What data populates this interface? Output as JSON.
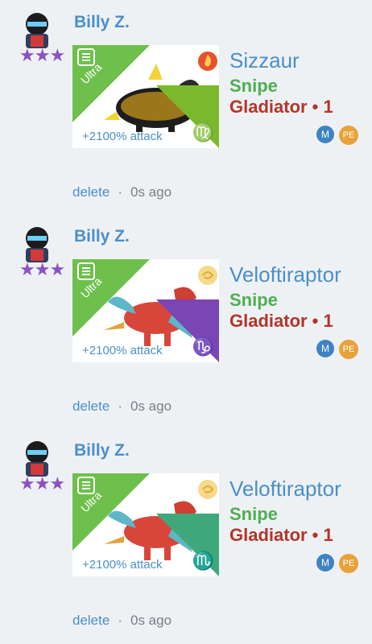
{
  "posts": [
    {
      "username": "Billy Z.",
      "stars": "★★★",
      "badge": "Ultra",
      "attack": "+2100% attack",
      "zodiac": "♍",
      "zodiac_color": "#7ab92c",
      "element_icon": "fire-icon",
      "dragon_name": "Sizzaur",
      "tag": "Snipe",
      "rank": "Gladiator • 1",
      "badges": [
        "M",
        "PE"
      ],
      "delete": "delete",
      "time": "0s ago"
    },
    {
      "username": "Billy Z.",
      "stars": "★★★",
      "badge": "Ultra",
      "attack": "+2100% attack",
      "zodiac": "♑",
      "zodiac_color": "#7a46b4",
      "element_icon": "wind-icon",
      "dragon_name": "Veloftiraptor",
      "tag": "Snipe",
      "rank": "Gladiator • 1",
      "badges": [
        "M",
        "PE"
      ],
      "delete": "delete",
      "time": "0s ago"
    },
    {
      "username": "Billy Z.",
      "stars": "★★★",
      "badge": "Ultra",
      "attack": "+2100% attack",
      "zodiac": "♏",
      "zodiac_color": "#3fa87a",
      "element_icon": "wind-icon",
      "dragon_name": "Veloftiraptor",
      "tag": "Snipe",
      "rank": "Gladiator • 1",
      "badges": [
        "M",
        "PE"
      ],
      "delete": "delete",
      "time": "0s ago"
    }
  ]
}
